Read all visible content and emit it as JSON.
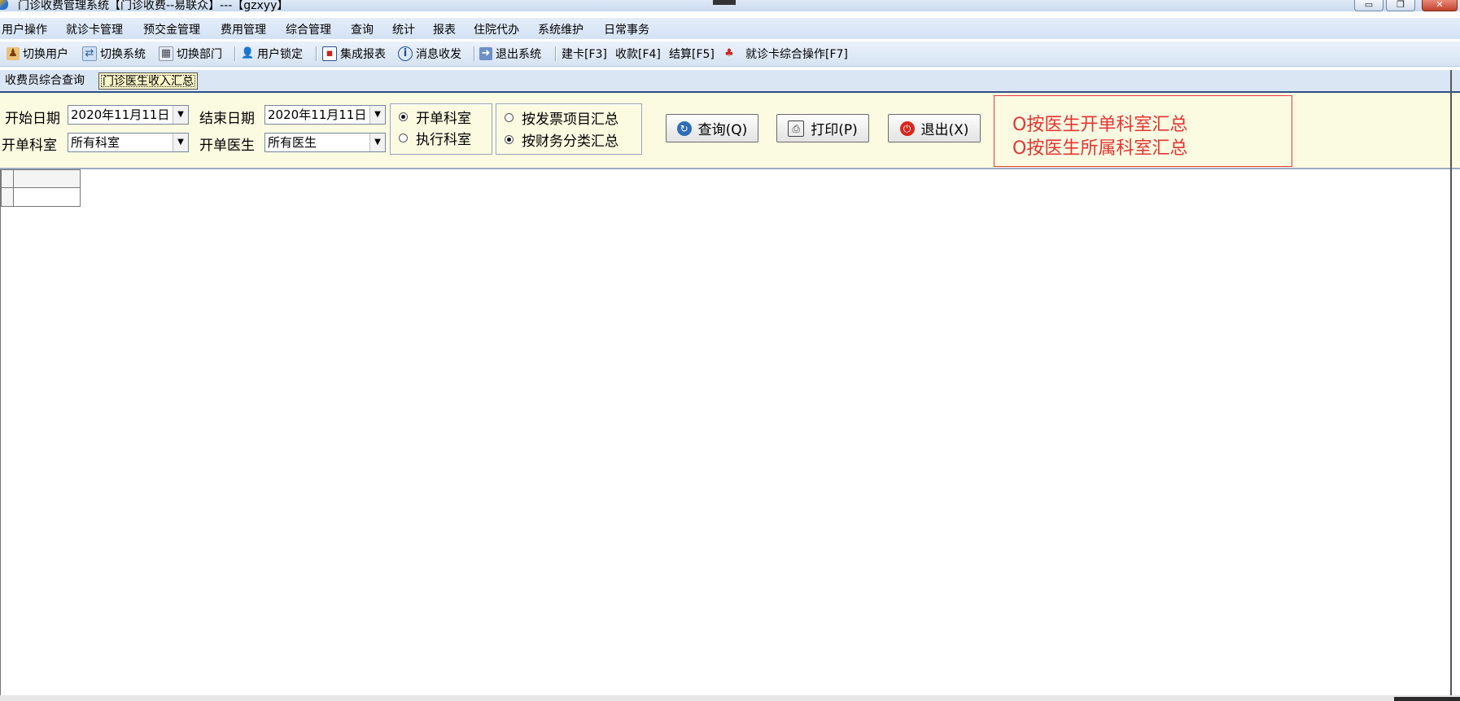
{
  "window": {
    "title": "门诊收费管理系统【门诊收费--易联众】---【gzxyy】",
    "controls": {
      "minimize": "▭",
      "maximize": "❐",
      "close": "✕"
    }
  },
  "menu": {
    "items": [
      "用户操作",
      "就诊卡管理",
      "预交金管理",
      "费用管理",
      "综合管理",
      "查询",
      "统计",
      "报表",
      "住院代办",
      "系统维护",
      "日常事务"
    ]
  },
  "toolbar": {
    "items": [
      {
        "label": "切换用户",
        "icon": "users-switch-icon"
      },
      {
        "label": "切换系统",
        "icon": "system-switch-icon"
      },
      {
        "label": "切换部门",
        "icon": "department-switch-icon"
      },
      {
        "label": "用户锁定",
        "icon": "user-lock-icon"
      },
      {
        "label": "集成报表",
        "icon": "report-icon"
      },
      {
        "label": "消息收发",
        "icon": "info-icon"
      },
      {
        "label": "退出系统",
        "icon": "exit-door-icon"
      },
      {
        "label": "建卡[F3]"
      },
      {
        "label": "收款[F4]"
      },
      {
        "label": "结算[F5]"
      },
      {
        "label": "就诊卡综合操作[F7]",
        "icon": "card-ops-icon"
      }
    ]
  },
  "tabs": [
    {
      "label": "收费员综合查询",
      "active": false
    },
    {
      "label": "门诊医生收入汇总",
      "active": true
    }
  ],
  "filters": {
    "start_date_label": "开始日期",
    "start_date_value": "2020年11月11日",
    "end_date_label": "结束日期",
    "end_date_value": "2020年11月11日",
    "dept_label": "开单科室",
    "dept_value": "所有科室",
    "doctor_label": "开单医生",
    "doctor_value": "所有医生",
    "dept_mode": {
      "options": [
        "开单科室",
        "执行科室"
      ],
      "selected": "开单科室"
    },
    "summary_mode": {
      "options": [
        "按发票项目汇总",
        "按财务分类汇总"
      ],
      "selected": "按财务分类汇总"
    }
  },
  "actions": {
    "query": "查询(Q)",
    "print": "打印(P)",
    "exit": "退出(X)"
  },
  "annotation": {
    "lines": [
      "O按医生开单科室汇总",
      "O按医生所属科室汇总"
    ],
    "color": "#e53434"
  },
  "colors": {
    "menu_bg": "#d4e2f4",
    "filter_panel_bg": "#fbfbe2",
    "active_tab_bg": "#fbf6c8"
  }
}
